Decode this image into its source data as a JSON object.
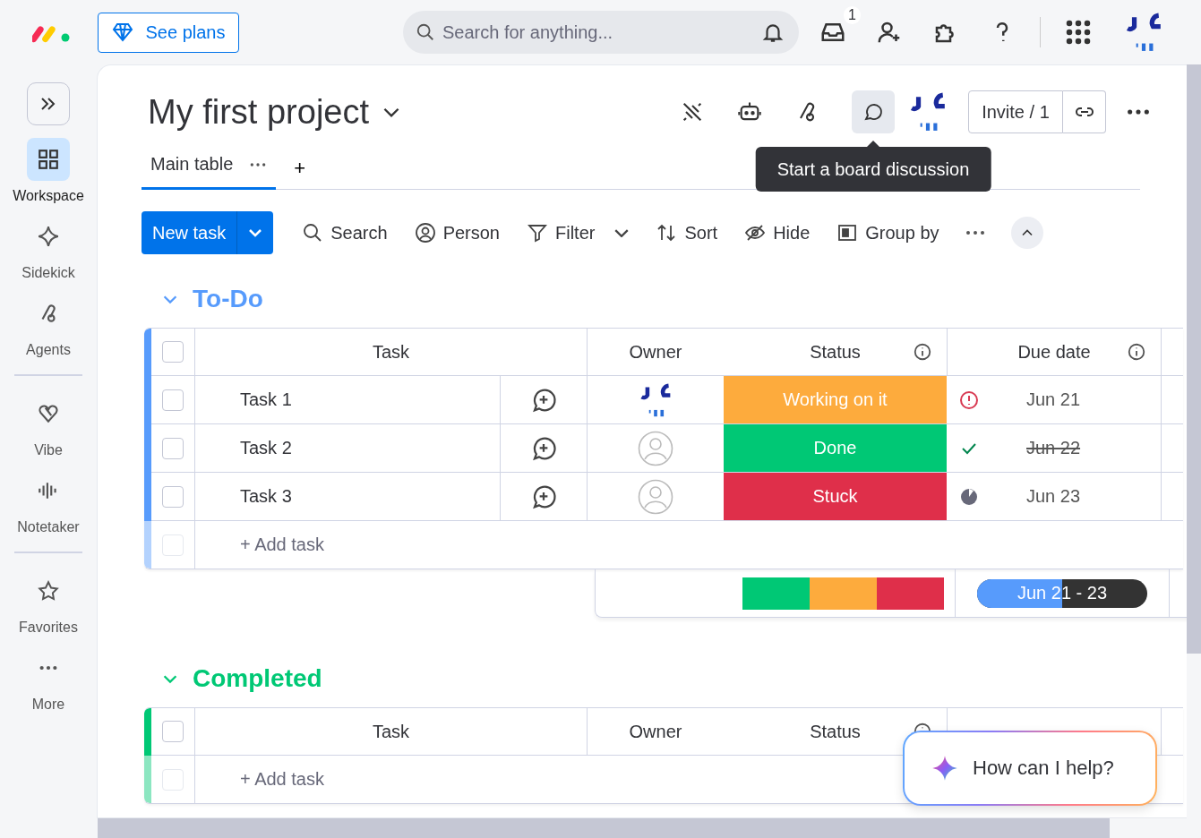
{
  "topbar": {
    "see_plans": "See plans",
    "search": {
      "placeholder": "Search for anything..."
    },
    "inbox_badge": "1"
  },
  "sidebar": {
    "groups": [
      [
        {
          "label": "Workspace",
          "selected": true
        },
        {
          "label": "Sidekick",
          "selected": false
        },
        {
          "label": "Agents",
          "selected": false
        }
      ],
      [
        {
          "label": "Vibe",
          "selected": false
        },
        {
          "label": "Notetaker",
          "selected": false
        }
      ],
      [
        {
          "label": "Favorites",
          "selected": false
        },
        {
          "label": "More",
          "selected": false
        }
      ]
    ]
  },
  "board": {
    "title": "My first project",
    "views": [
      {
        "label": "Main table",
        "selected": true
      }
    ],
    "add_view": "+",
    "tooltip": "Start a board discussion",
    "invite": "Invite / 1"
  },
  "toolbar": {
    "new_task": "New task",
    "items": [
      "Search",
      "Person",
      "Filter",
      "Sort",
      "Hide",
      "Group by"
    ]
  },
  "groups": [
    {
      "title": "To-Do",
      "color": "#579bfc",
      "all_checked": false,
      "columns": [
        "Task",
        "Owner",
        "Status",
        "Due date"
      ],
      "rows": [
        {
          "task": "Task 1",
          "checked": false,
          "assigned": true,
          "status": {
            "label": "Working on it",
            "color": "#fdab3d"
          },
          "due": {
            "text": "Jun 21",
            "kind": "overdue"
          }
        },
        {
          "task": "Task 2",
          "checked": false,
          "assigned": false,
          "status": {
            "label": "Done",
            "color": "#00c875"
          },
          "due": {
            "text": "Jun 22",
            "kind": "done"
          }
        },
        {
          "task": "Task 3",
          "checked": false,
          "assigned": false,
          "status": {
            "label": "Stuck",
            "color": "#df2f4a"
          },
          "due": {
            "text": "Jun 23",
            "kind": "pending"
          }
        }
      ],
      "add_row": {
        "label": "+ Add task",
        "disabled": true
      },
      "summary": {
        "status_segments": [
          {
            "color": "#00c875"
          },
          {
            "color": "#fdab3d"
          },
          {
            "color": "#df2f4a"
          }
        ],
        "date_range": "Jun 21 - 23",
        "level": 0.5
      }
    },
    {
      "title": "Completed",
      "color": "#00c875",
      "all_checked": false,
      "columns": [
        "Task",
        "Owner",
        "Status"
      ],
      "add_row": {
        "label": "+ Add task",
        "disabled": true
      }
    }
  ],
  "help": {
    "text": "How can I help?"
  }
}
